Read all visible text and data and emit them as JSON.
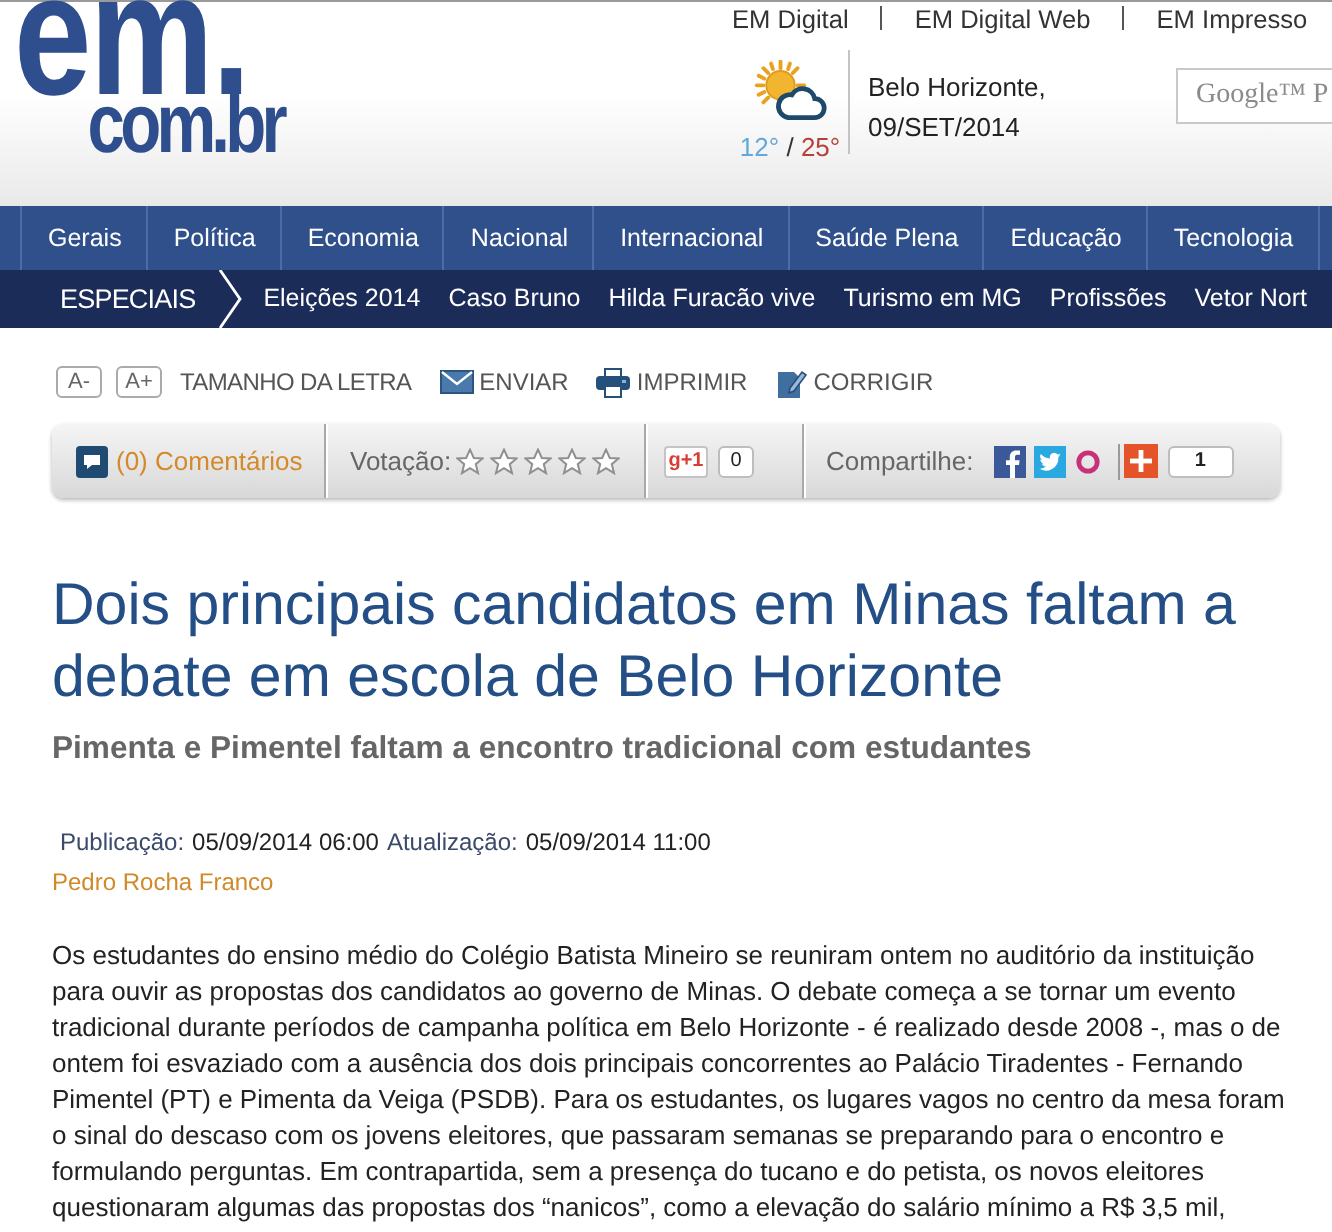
{
  "header": {
    "links": [
      "EM Digital",
      "EM Digital Web",
      "EM Impresso"
    ],
    "logo": {
      "top": "em.",
      "bottom": "com.br"
    },
    "weather": {
      "low": "12°",
      "separator": "/",
      "high": "25°"
    },
    "location": {
      "city": "Belo Horizonte,",
      "date": "09/SET/2014"
    },
    "search": {
      "placeholder": "Google™ P"
    }
  },
  "nav": [
    "Gerais",
    "Política",
    "Economia",
    "Nacional",
    "Internacional",
    "Saúde Plena",
    "Educação",
    "Tecnologia"
  ],
  "specials": {
    "title": "ESPECIAIS",
    "items": [
      "Eleições 2014",
      "Caso Bruno",
      "Hilda Furacão vive",
      "Turismo em MG",
      "Profissões",
      "Vetor Nort"
    ]
  },
  "tools": {
    "smaller": "A-",
    "larger": "A+",
    "font_label": "TAMANHO DA LETRA",
    "actions": [
      {
        "kind": "mail",
        "label": "ENVIAR"
      },
      {
        "kind": "print",
        "label": "IMPRIMIR"
      },
      {
        "kind": "edit",
        "label": "CORRIGIR"
      }
    ]
  },
  "social_bar": {
    "comments": "(0) Comentários",
    "vote_label": "Votação:",
    "stars": 0,
    "plus_one": {
      "label": "g+1",
      "count": "0"
    },
    "share_label": "Compartilhe:",
    "share_count": "1"
  },
  "article": {
    "headline": "Dois principais candidatos em Minas faltam a debate em escola de Belo Horizonte",
    "subtitle": "Pimenta e Pimentel faltam a encontro tradicional com estudantes",
    "published_label": "Publicação:",
    "published": "05/09/2014 06:00",
    "updated_label": "Atualização:",
    "updated": "05/09/2014 11:00",
    "author": "Pedro Rocha Franco",
    "body": "Os estudantes do ensino médio do Colégio Batista Mineiro se reuniram ontem no auditório da instituição para ouvir as propostas dos candidatos ao governo de Minas. O debate começa a se tornar um evento tradicional durante períodos de campanha política em Belo Horizonte - é realizado desde 2008 -, mas o de ontem foi esvaziado com a ausência dos dois principais concorrentes ao Palácio Tiradentes - Fernando Pimentel (PT) e Pimenta da Veiga (PSDB). Para os estudantes, os lugares vagos no centro da mesa foram o sinal do descaso com os jovens eleitores, que passaram semanas se preparando para o encontro e formulando perguntas. Em contrapartida, sem a presença do tucano e do petista, os novos eleitores questionaram algumas das propostas dos “nanicos”, como a elevação do salário mínimo a R$ 3,5 mil,"
  }
}
